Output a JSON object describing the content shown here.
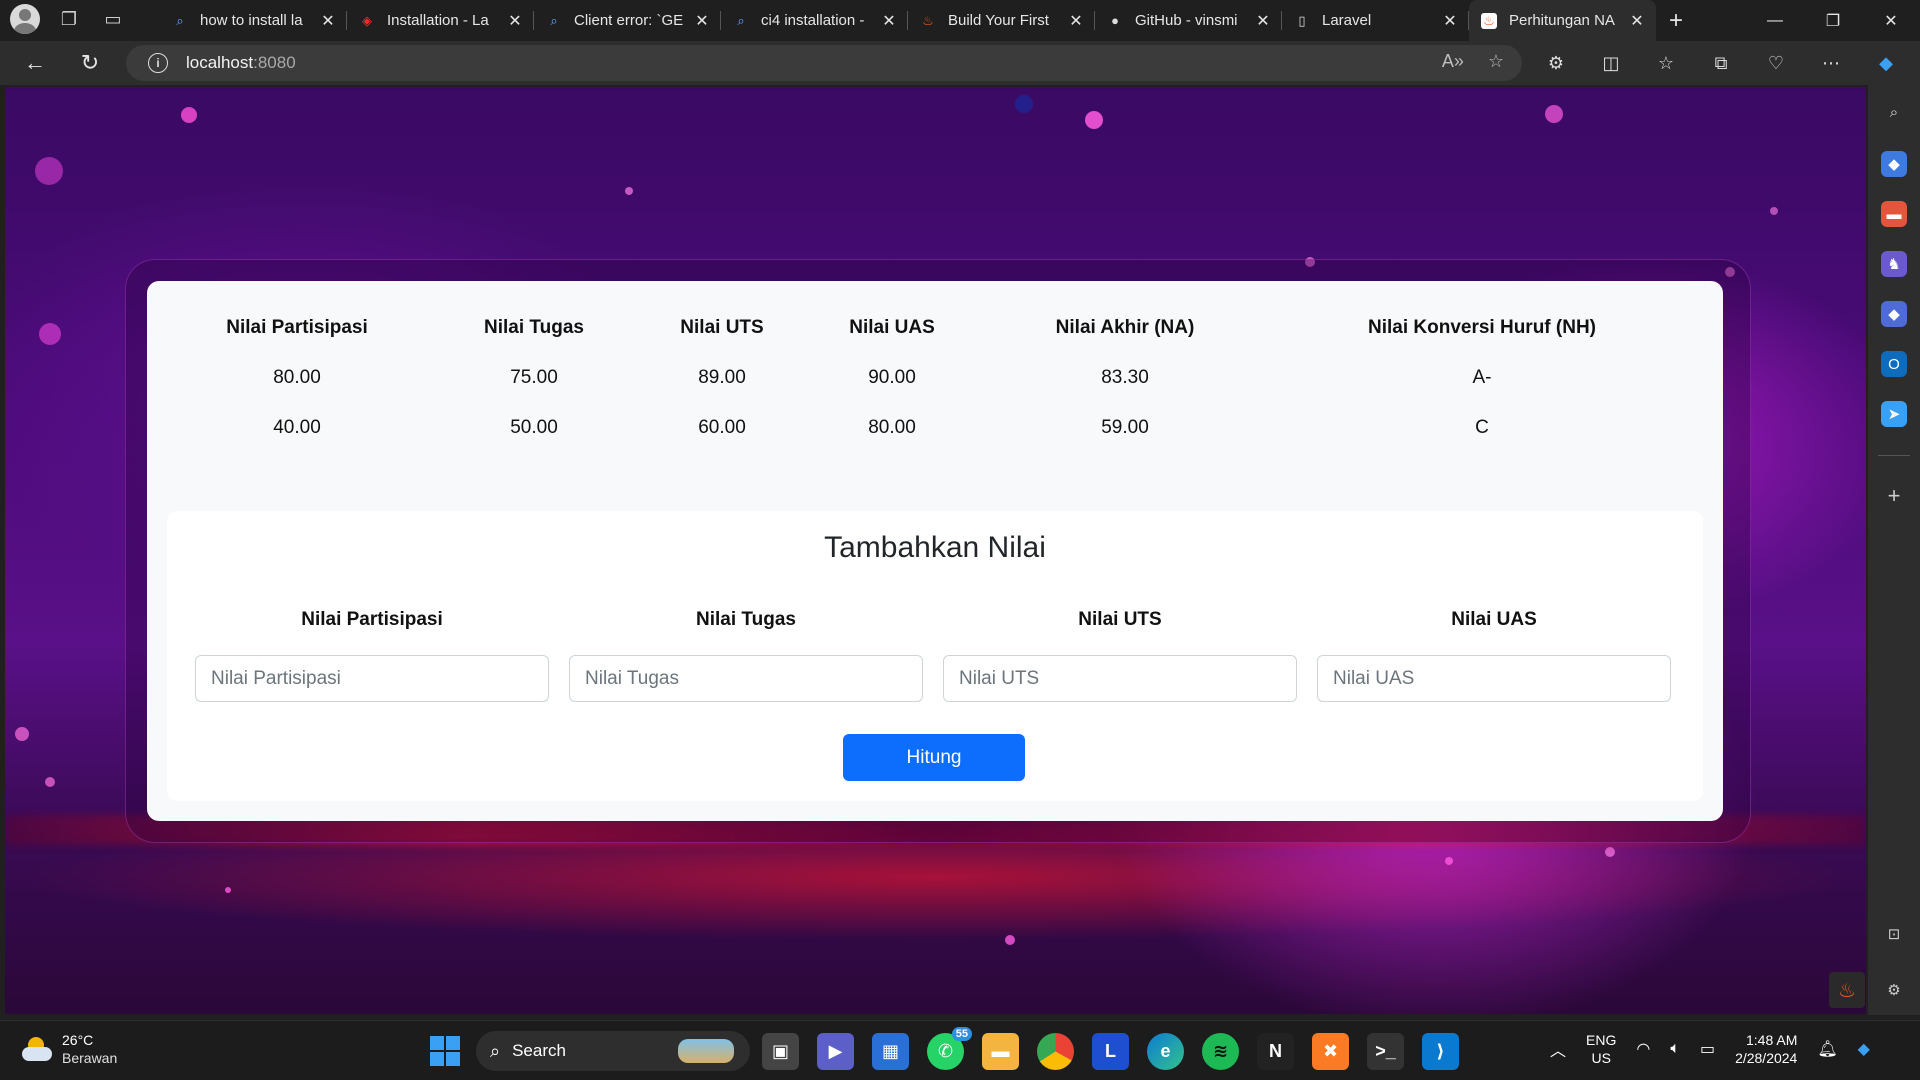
{
  "browser": {
    "tabs": [
      {
        "title": "how to install la",
        "favicon": "search-icon"
      },
      {
        "title": "Installation - La",
        "favicon": "laravel-icon"
      },
      {
        "title": "Client error: `GE",
        "favicon": "search-icon"
      },
      {
        "title": "ci4 installation -",
        "favicon": "search-icon"
      },
      {
        "title": "Build Your First",
        "favicon": "codeigniter-icon"
      },
      {
        "title": "GitHub - vinsmi",
        "favicon": "github-icon"
      },
      {
        "title": "Laravel",
        "favicon": "page-icon"
      },
      {
        "title": "Perhitungan NA",
        "favicon": "codeigniter-icon",
        "active": true
      }
    ],
    "url_host": "localhost",
    "url_port": ":8080"
  },
  "grades_table": {
    "headers": [
      "Nilai Partisipasi",
      "Nilai Tugas",
      "Nilai UTS",
      "Nilai UAS",
      "Nilai Akhir (NA)",
      "Nilai Konversi Huruf (NH)"
    ],
    "rows": [
      [
        "80.00",
        "75.00",
        "89.00",
        "90.00",
        "83.30",
        "A-"
      ],
      [
        "40.00",
        "50.00",
        "60.00",
        "80.00",
        "59.00",
        "C"
      ]
    ]
  },
  "form": {
    "title": "Tambahkan Nilai",
    "fields": [
      {
        "label": "Nilai Partisipasi",
        "placeholder": "Nilai Partisipasi",
        "value": ""
      },
      {
        "label": "Nilai Tugas",
        "placeholder": "Nilai Tugas",
        "value": ""
      },
      {
        "label": "Nilai UTS",
        "placeholder": "Nilai UTS",
        "value": ""
      },
      {
        "label": "Nilai UAS",
        "placeholder": "Nilai UAS",
        "value": ""
      }
    ],
    "submit_label": "Hitung"
  },
  "taskbar": {
    "weather_temp": "26°C",
    "weather_desc": "Berawan",
    "search_label": "Search",
    "whatsapp_badge": "55",
    "lang_line1": "ENG",
    "lang_line2": "US",
    "time": "1:48 AM",
    "date": "2/28/2024"
  },
  "colors": {
    "primary_button": "#0d6efd",
    "card_background": "#f8f9fa"
  }
}
